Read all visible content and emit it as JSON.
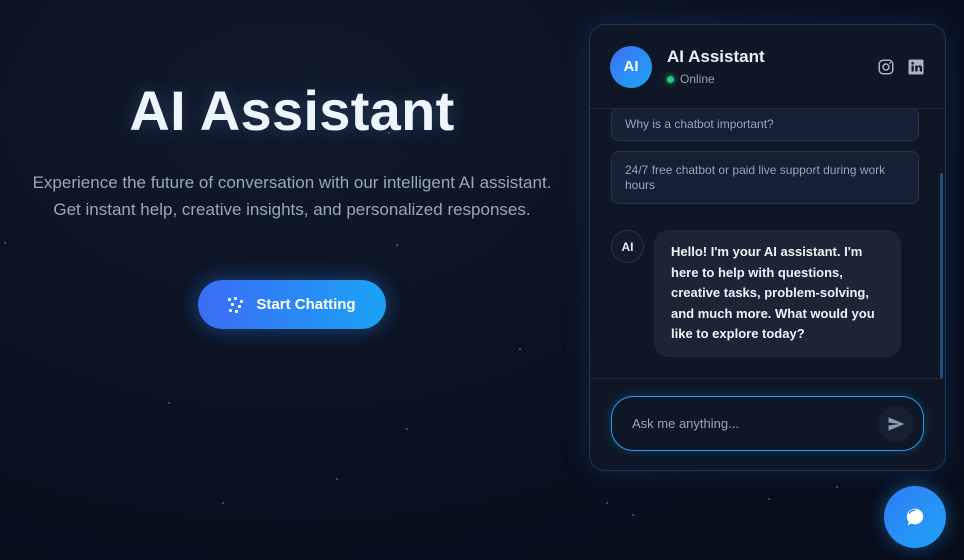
{
  "hero": {
    "title": "AI Assistant",
    "subtitle": "Experience the future of conversation with our intelligent AI assistant. Get instant help, creative insights, and personalized responses.",
    "cta_label": "Start Chatting",
    "cta_icon": "sparkle-icon"
  },
  "chat": {
    "avatar_text": "AI",
    "title": "AI Assistant",
    "status": "Online",
    "status_color": "#22d07a",
    "socials": [
      "instagram-icon",
      "linkedin-icon"
    ],
    "suggestions": [
      "Why is a chatbot important?",
      "24/7 free chatbot or paid live support during work hours"
    ],
    "bot_avatar_text": "AI",
    "bot_message": "Hello! I'm your AI assistant. I'm here to help with questions, creative tasks, problem-solving, and much more. What would you like to explore today?",
    "input_placeholder": "Ask me anything...",
    "send_icon": "send-icon"
  },
  "fab_icon": "chat-bubble-icon",
  "colors": {
    "accent_start": "#3b6cf5",
    "accent_end": "#1aa3f5",
    "background": "#0a1020"
  }
}
